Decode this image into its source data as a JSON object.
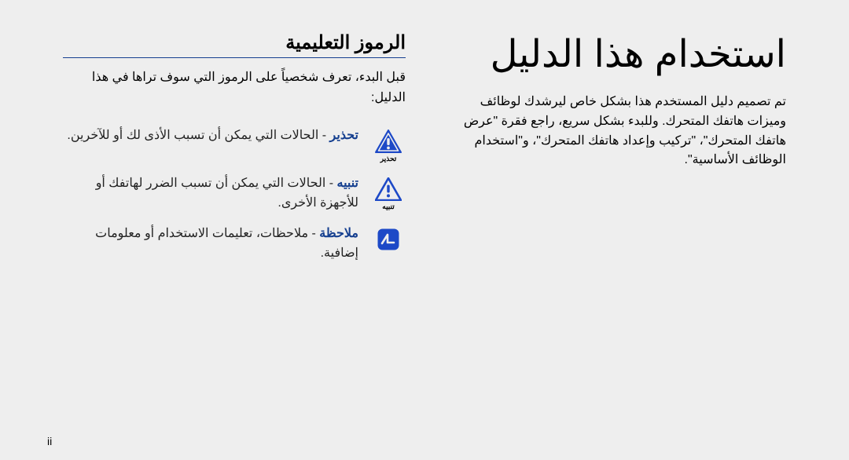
{
  "page_number": "ii",
  "right_column": {
    "title": "استخدام هذا الدليل",
    "body": "تم تصميم دليل المستخدم هذا بشكل خاص ليرشدك لوظائف وميزات هاتفك المتحرك. وللبدء بشكل سريع، راجع فقرة \"عرض هاتفك المتحرك\"، \"تركيب وإعداد هاتفك المتحرك\"، و\"استخدام الوظائف الأساسية\"."
  },
  "left_column": {
    "heading": "الرموز التعليمية",
    "intro": "قبل البدء، تعرف شخصياً على الرموز التي سوف تراها في هذا الدليل:",
    "items": [
      {
        "icon": "warning-triangle-icon",
        "caption": "تحذير",
        "label": "تحذير",
        "text": " - الحالات التي يمكن أن تسبب الأذى لك أو للآخرين."
      },
      {
        "icon": "caution-triangle-icon",
        "caption": "تنبيه",
        "label": "تنبيه",
        "text": " - الحالات التي يمكن أن تسبب الضرر لهاتفك أو للأجهزة الأخرى."
      },
      {
        "icon": "note-square-icon",
        "caption": "",
        "label": "ملاحظة",
        "text": " - ملاحظات، تعليمات الاستخدام أو معلومات إضافية."
      }
    ]
  }
}
